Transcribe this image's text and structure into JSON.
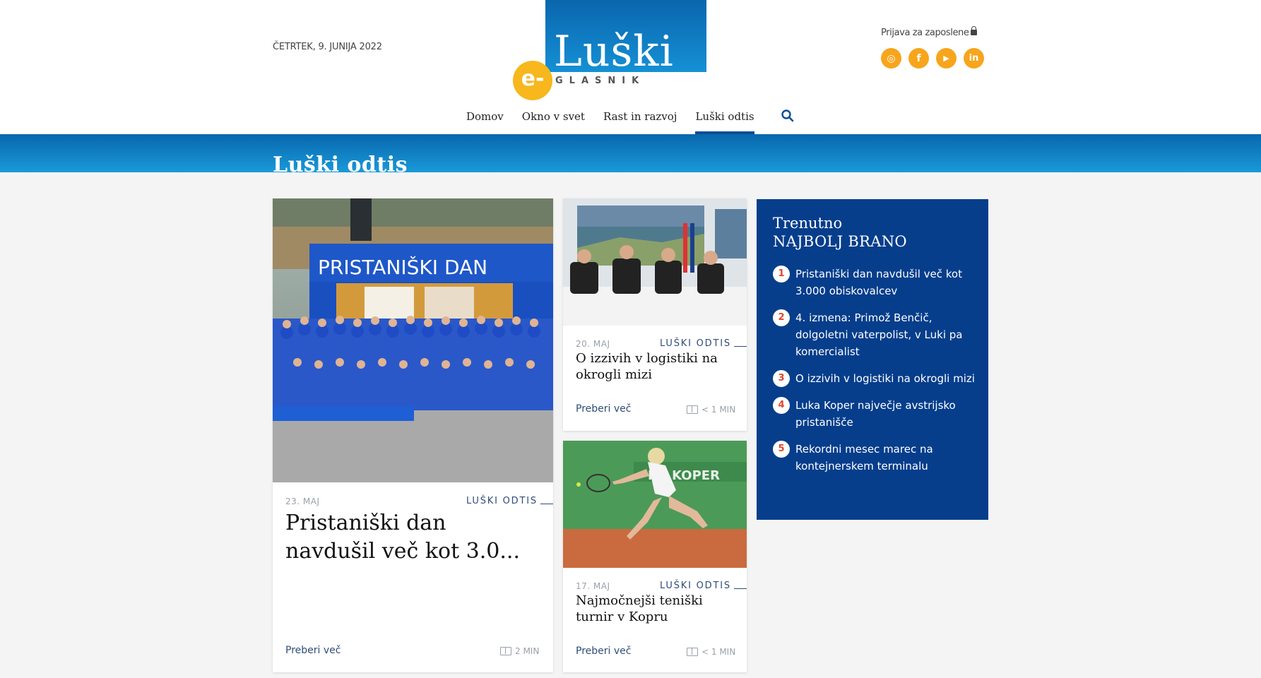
{
  "header": {
    "date": "ČETRTEK, 9. JUNIJA 2022",
    "logo": {
      "word": "Luški",
      "badge": "e-",
      "subtitle": "GLASNIK"
    },
    "login_label": "Prijava za zaposlene",
    "social": [
      {
        "icon": "instagram-icon",
        "glyph": "◎"
      },
      {
        "icon": "facebook-icon",
        "glyph": "f"
      },
      {
        "icon": "youtube-icon",
        "glyph": "▶"
      },
      {
        "icon": "linkedin-icon",
        "glyph": "in"
      }
    ],
    "nav": [
      {
        "label": "Domov",
        "active": false
      },
      {
        "label": "Okno v svet",
        "active": false
      },
      {
        "label": "Rast in razvoj",
        "active": false
      },
      {
        "label": "Luški odtis",
        "active": true
      }
    ]
  },
  "banner": {
    "title": "Luški odtis"
  },
  "articles": [
    {
      "date": "23. MAJ",
      "category": "LUŠKI ODTIS",
      "title": "Pristaniški dan navdušil več kot 3.0...",
      "read_more": "Preberi več",
      "read_time": "2 MIN",
      "image_banner": "PRISTANIŠKI DAN"
    },
    {
      "date": "20. MAJ",
      "category": "LUŠKI ODTIS",
      "title": "O izzivih v logistiki na okrogli mizi",
      "read_more": "Preberi več",
      "read_time": "< 1 MIN"
    },
    {
      "date": "17. MAJ",
      "category": "LUŠKI ODTIS",
      "title": "Najmočnejši teniški turnir v Kopru",
      "read_more": "Preberi več",
      "read_time": "< 1 MIN"
    }
  ],
  "popular": {
    "title_line1": "Trenutno",
    "title_line2": "NAJBOLJ BRANO",
    "items": [
      {
        "num": "1",
        "text": "Pristaniški dan navdušil več kot 3.000 obiskovalcev"
      },
      {
        "num": "2",
        "text": "4. izmena: Primož Benčič, dolgoletni vaterpolist, v Luki pa komercialist"
      },
      {
        "num": "3",
        "text": "O izzivih v logistiki na okrogli mizi"
      },
      {
        "num": "4",
        "text": "Luka Koper največje avstrijsko pristanišče"
      },
      {
        "num": "5",
        "text": "Rekordni mesec marec na kontejnerskem terminalu"
      }
    ]
  },
  "colors": {
    "brand_blue": "#063e8c",
    "banner_blue": "#1590d5",
    "accent_orange": "#f7a51d",
    "number_red": "#e0452b"
  }
}
